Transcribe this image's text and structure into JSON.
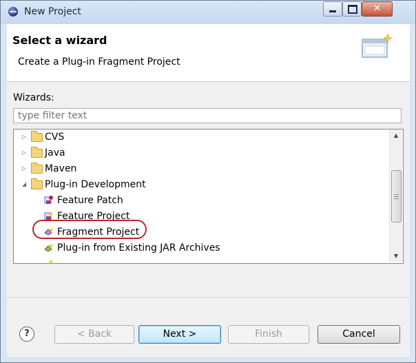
{
  "window": {
    "title": "New Project"
  },
  "header": {
    "title": "Select a wizard",
    "description": "Create a Plug-in Fragment Project"
  },
  "wizards": {
    "label": "Wizards:",
    "filter_placeholder": "type filter text"
  },
  "tree": {
    "items": [
      {
        "label": "CVS",
        "expanded": false,
        "type": "folder"
      },
      {
        "label": "Java",
        "expanded": false,
        "type": "folder"
      },
      {
        "label": "Maven",
        "expanded": false,
        "type": "folder"
      },
      {
        "label": "Plug-in Development",
        "expanded": true,
        "type": "folder"
      },
      {
        "label": "Feature Patch",
        "type": "wizard"
      },
      {
        "label": "Feature Project",
        "type": "wizard"
      },
      {
        "label": "Fragment Project",
        "type": "wizard",
        "selected": true
      },
      {
        "label": "Plug-in from Existing JAR Archives",
        "type": "wizard"
      }
    ]
  },
  "buttons": {
    "help": "?",
    "back": "< Back",
    "next": "Next >",
    "finish": "Finish",
    "cancel": "Cancel"
  },
  "colors": {
    "highlight_ring": "#b8262c",
    "default_button": "#3c7fb1"
  }
}
